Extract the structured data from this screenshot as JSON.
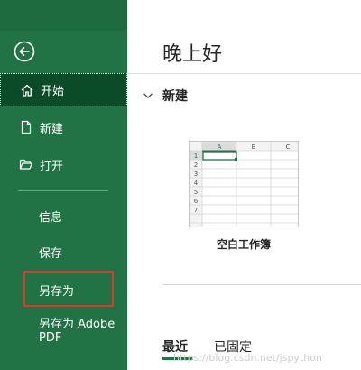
{
  "sidebar": {
    "back_icon": "arrow-left-circle-icon",
    "items": [
      {
        "label": "开始",
        "icon": "home-icon",
        "active": true
      },
      {
        "label": "新建",
        "icon": "new-document-icon"
      },
      {
        "label": "打开",
        "icon": "folder-open-icon"
      },
      {
        "label": "信息"
      },
      {
        "label": "保存"
      },
      {
        "label": "另存为",
        "highlighted": true
      },
      {
        "label": "另存为 Adobe PDF"
      }
    ],
    "colors": {
      "background": "#217346",
      "active": "#0c4b28",
      "highlight_border": "#e3372d"
    }
  },
  "main": {
    "greeting": "晚上好",
    "new_section": {
      "title": "新建",
      "template": {
        "label": "空白工作簿",
        "columns": [
          "A",
          "B",
          "C"
        ],
        "rows": [
          "1",
          "2",
          "3",
          "4",
          "5",
          "6",
          "7"
        ]
      }
    },
    "tabs": [
      {
        "label": "最近",
        "active": true
      },
      {
        "label": "已固定"
      }
    ]
  },
  "watermark": "https://blog.csdn.net/jspython"
}
